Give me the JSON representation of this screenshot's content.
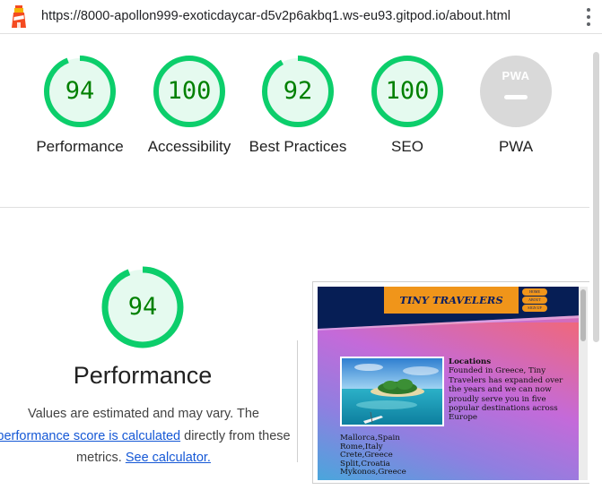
{
  "url_bar": {
    "url": "https://8000-apollon999-exoticdaycar-d5v2p6akbq1.ws-eu93.gitpod.io/about.html",
    "logo_icon": "lighthouse-icon",
    "menu_icon": "kebab-menu-icon"
  },
  "gauges": [
    {
      "label": "Performance",
      "score": "94",
      "value": 94
    },
    {
      "label": "Accessibility",
      "score": "100",
      "value": 100
    },
    {
      "label": "Best Practices",
      "score": "92",
      "value": 92
    },
    {
      "label": "SEO",
      "score": "100",
      "value": 100
    },
    {
      "label": "PWA",
      "badge_text": "PWA"
    }
  ],
  "colors": {
    "pass": "#0cce6b",
    "pass_fill": "#e5faef",
    "pass_text": "#008000",
    "pwa_gray": "#d9d9d9",
    "link": "#1558d6"
  },
  "performance": {
    "score": "94",
    "value": 94,
    "title": "Performance",
    "desc_prefix": "Values are estimated and may vary. The",
    "desc_link1": "performance score is calculated",
    "desc_mid": "directly from these metrics.",
    "desc_link2": "See calculator."
  },
  "thumbnail": {
    "brand": "TINY TRAVELERS",
    "nav": [
      "HOME",
      "ABOUT",
      "SIGN UP"
    ],
    "heading": "Locations",
    "body": "Founded in Greece, Tiny Travelers has expanded over the years and we can now proudly serve you in five popular destinations across Europe",
    "destinations": [
      "Mallorca,Spain",
      "Rome,Italy",
      "Crete,Greece",
      "Split,Croatia",
      "Mykonos,Greece"
    ]
  }
}
